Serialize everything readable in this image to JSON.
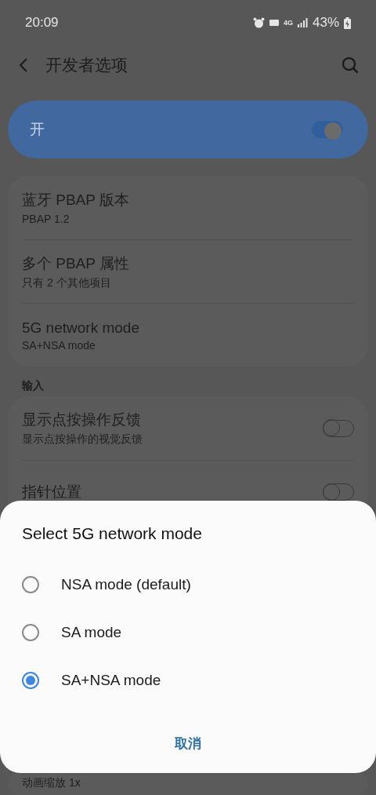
{
  "status_bar": {
    "time": "20:09",
    "network": "4G",
    "battery": "43%"
  },
  "header": {
    "title": "开发者选项"
  },
  "master_switch": {
    "label": "开",
    "on": true
  },
  "groups": [
    {
      "items": [
        {
          "kind": "text",
          "title": "蓝牙 PBAP 版本",
          "subtitle": "PBAP 1.2"
        },
        {
          "kind": "text",
          "title": "多个 PBAP 属性",
          "subtitle": "只有 2 个其他项目"
        },
        {
          "kind": "text",
          "title": "5G network mode",
          "subtitle": "SA+NSA mode"
        }
      ]
    },
    {
      "header": "输入",
      "items": [
        {
          "kind": "switch",
          "title": "显示点按操作反馈",
          "subtitle": "显示点按操作的视觉反馈",
          "on": false
        },
        {
          "kind": "switch",
          "title": "指针位置",
          "on": false
        }
      ]
    },
    {
      "items": [
        {
          "kind": "text",
          "subtitle": "动画缩放 1x"
        }
      ]
    }
  ],
  "dialog": {
    "title": "Select 5G network mode",
    "options": [
      {
        "label": "NSA mode (default)",
        "selected": false
      },
      {
        "label": "SA mode",
        "selected": false
      },
      {
        "label": "SA+NSA mode",
        "selected": true
      }
    ],
    "cancel": "取消"
  }
}
